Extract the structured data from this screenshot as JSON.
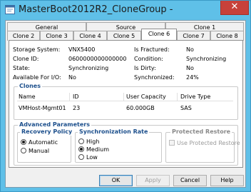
{
  "window": {
    "title": "MasterBoot2012R2_CloneGroup - Clone Pr...",
    "close_glyph": "✕",
    "app_icon": "window-app-icon"
  },
  "tabs_top": [
    {
      "label": "General"
    },
    {
      "label": "Source"
    },
    {
      "label": "Clone 1"
    }
  ],
  "tabs_bottom": [
    {
      "label": "Clone 2"
    },
    {
      "label": "Clone 3"
    },
    {
      "label": "Clone 4"
    },
    {
      "label": "Clone 5"
    },
    {
      "label": "Clone 6"
    },
    {
      "label": "Clone 7"
    },
    {
      "label": "Clone 8"
    }
  ],
  "properties": {
    "storage_system": {
      "label": "Storage System:",
      "value": "VNX5400"
    },
    "clone_id": {
      "label": "Clone ID:",
      "value": "0600000000000000"
    },
    "state": {
      "label": "State:",
      "value": "Synchronizing"
    },
    "available_io": {
      "label": "Available For I/O:",
      "value": "No"
    },
    "is_fractured": {
      "label": "Is Fractured:",
      "value": "No"
    },
    "condition": {
      "label": "Condition:",
      "value": "Synchronizing"
    },
    "is_dirty": {
      "label": "Is Dirty:",
      "value": "No"
    },
    "synchronized": {
      "label": "Synchronized:",
      "value": "24%"
    }
  },
  "clones": {
    "title": "Clones",
    "columns": [
      "Name",
      "ID",
      "User Capacity",
      "Drive Type"
    ],
    "rows": [
      [
        "VMHost-Mgmt01",
        "23",
        "60.000GB",
        "SAS"
      ]
    ]
  },
  "advanced": {
    "title": "Advanced Parameters",
    "recovery_policy": {
      "title": "Recovery Policy",
      "options": [
        "Automatic",
        "Manual"
      ],
      "selected": "Automatic"
    },
    "sync_rate": {
      "title": "Synchronization Rate",
      "options": [
        "High",
        "Medium",
        "Low"
      ],
      "selected": "Medium"
    },
    "protected_restore": {
      "title": "Protected Restore",
      "checkbox_label": "Use Protected Restore",
      "checked": false,
      "enabled": false
    }
  },
  "buttons": {
    "ok": "OK",
    "apply": "Apply",
    "cancel": "Cancel",
    "help": "Help"
  },
  "colors": {
    "title_bar": "#5fc0e8",
    "close_button": "#c7413a",
    "group_title": "#1c4f8c"
  }
}
